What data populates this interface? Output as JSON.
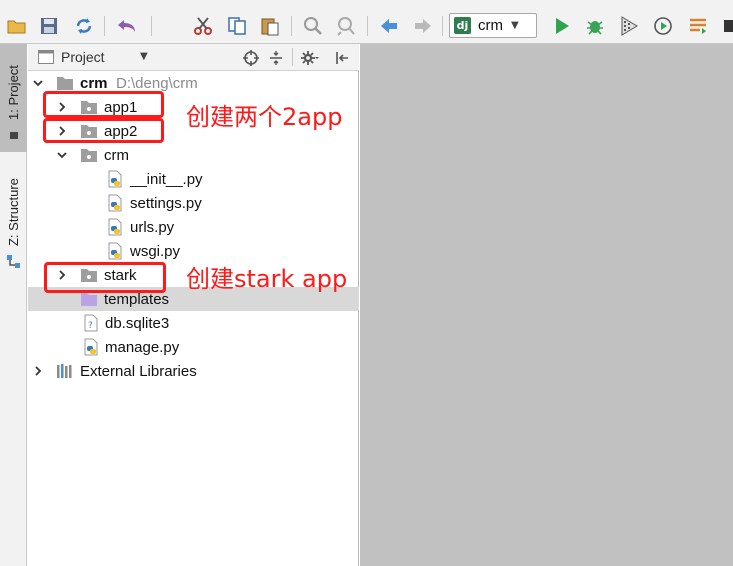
{
  "toolbar": {
    "run_config_label": "crm",
    "run_config_badge": "dj"
  },
  "left_strip": {
    "project_tab": "1: Project",
    "structure_tab": "Z: Structure"
  },
  "panel": {
    "title": "Project"
  },
  "tree": {
    "root": {
      "name": "crm",
      "path": "D:\\deng\\crm"
    },
    "app1": "app1",
    "app2": "app2",
    "crm_pkg": "crm",
    "init": "__init__.py",
    "settings": "settings.py",
    "urls": "urls.py",
    "wsgi": "wsgi.py",
    "stark": "stark",
    "templates": "templates",
    "db": "db.sqlite3",
    "manage": "manage.py",
    "external": "External Libraries"
  },
  "annotations": {
    "apps": "创建两个2app",
    "stark": "创建stark app"
  },
  "colors": {
    "annotation": "#ff1a1a",
    "editor_bg": "#c1c1c1",
    "selected_row": "#d8d8d8",
    "toolbar_bg": "#f2f2f2"
  }
}
